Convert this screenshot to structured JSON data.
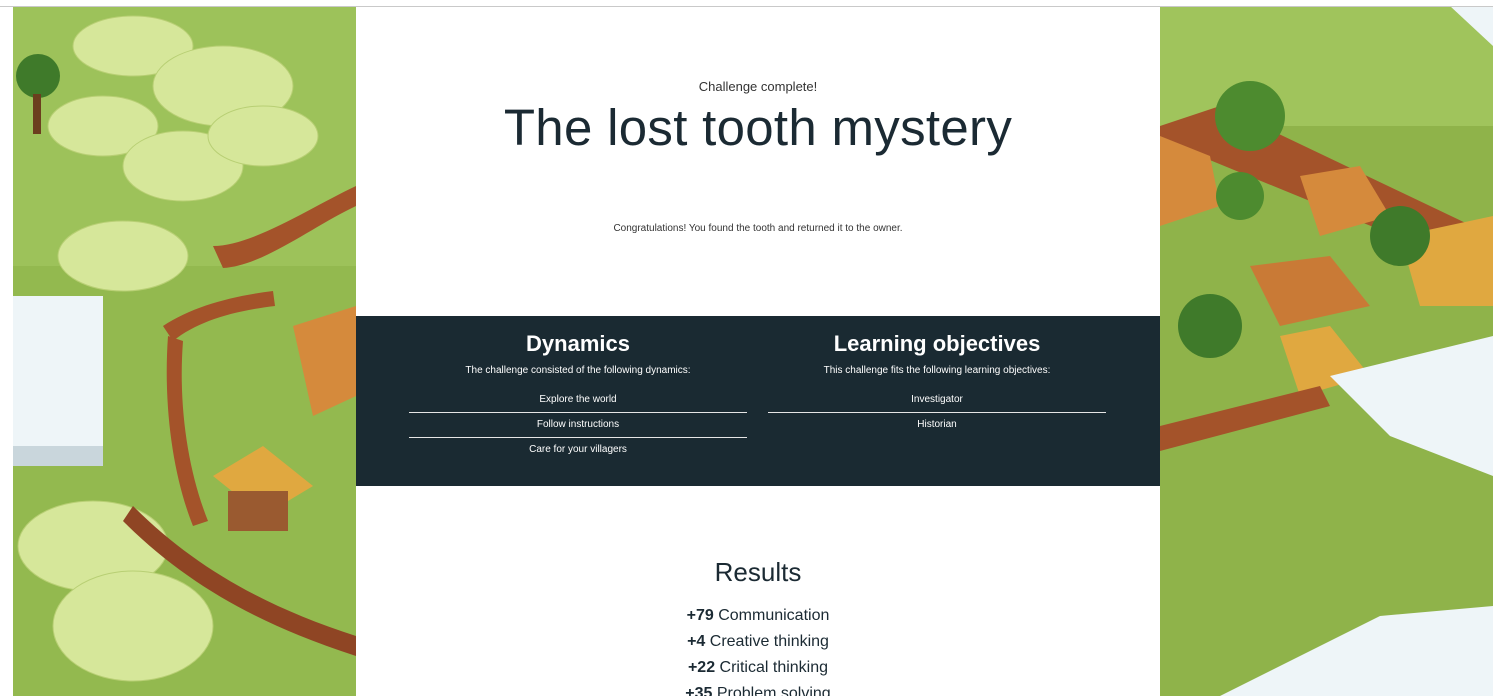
{
  "challenge": {
    "status": "Challenge complete!",
    "title": "The lost tooth mystery",
    "message": "Congratulations! You found the tooth and returned it to the owner."
  },
  "dynamics": {
    "heading": "Dynamics",
    "subtitle": "The challenge consisted of the following dynamics:",
    "items": [
      "Explore the world",
      "Follow instructions",
      "Care for your villagers"
    ]
  },
  "learning_objectives": {
    "heading": "Learning objectives",
    "subtitle": "This challenge fits the following learning objectives:",
    "items": [
      "Investigator",
      "Historian"
    ]
  },
  "results": {
    "heading": "Results",
    "items": [
      {
        "points": "+79",
        "skill": "Communication"
      },
      {
        "points": "+4",
        "skill": "Creative thinking"
      },
      {
        "points": "+22",
        "skill": "Critical thinking"
      },
      {
        "points": "+35",
        "skill": "Problem solving"
      }
    ]
  },
  "colors": {
    "band": "#1a2a32",
    "heading_text": "#1b2a33",
    "grass": "#8fb34a",
    "fence": "#a4532a",
    "roof": "#d58a3c"
  },
  "icons": [
    "minecraft-village-scene-left",
    "minecraft-village-scene-right"
  ]
}
